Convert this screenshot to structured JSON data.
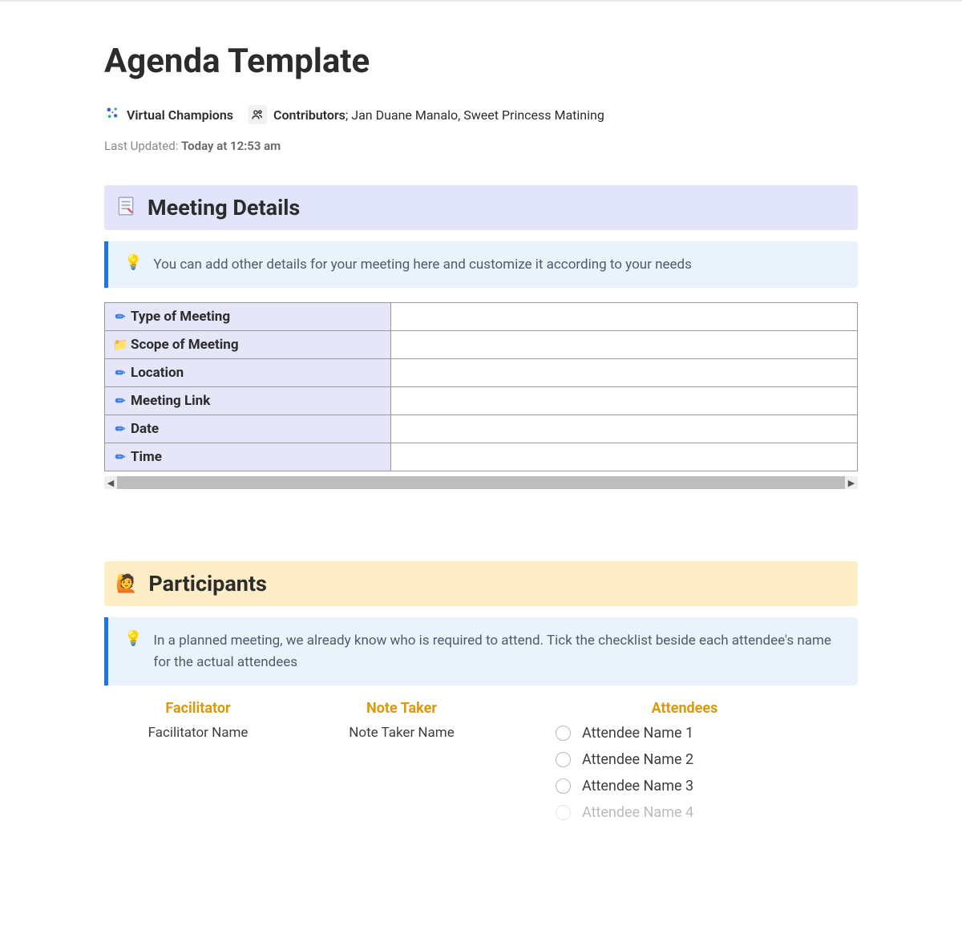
{
  "header": {
    "title": "Agenda Template",
    "team_name": "Virtual Champions",
    "contributors_label": "Contributors",
    "contributors_names": "Jan Duane Manalo, Sweet Princess Matining",
    "last_updated_label": "Last Updated:",
    "last_updated_value": "Today at 12:53 am"
  },
  "meeting_details": {
    "heading": "Meeting Details",
    "callout": "You can add other details for your meeting here and customize it according to your needs",
    "rows": [
      {
        "label": "Type of Meeting",
        "icon": "pencil",
        "value": ""
      },
      {
        "label": "Scope of Meeting",
        "icon": "folder",
        "value": ""
      },
      {
        "label": "Location",
        "icon": "pencil",
        "value": ""
      },
      {
        "label": "Meeting Link",
        "icon": "pencil",
        "value": ""
      },
      {
        "label": "Date",
        "icon": "pencil",
        "value": ""
      },
      {
        "label": "Time",
        "icon": "pencil",
        "value": ""
      }
    ]
  },
  "participants": {
    "heading": "Participants",
    "callout": "In a planned meeting, we already know who is required to attend. Tick the checklist beside each attendee's name for the actual attendees",
    "facilitator": {
      "label": "Facilitator",
      "name": "Facilitator Name"
    },
    "note_taker": {
      "label": "Note Taker",
      "name": "Note Taker Name"
    },
    "attendees": {
      "label": "Attendees",
      "list": [
        "Attendee Name 1",
        "Attendee Name 2",
        "Attendee Name 3",
        "Attendee Name 4"
      ]
    }
  }
}
